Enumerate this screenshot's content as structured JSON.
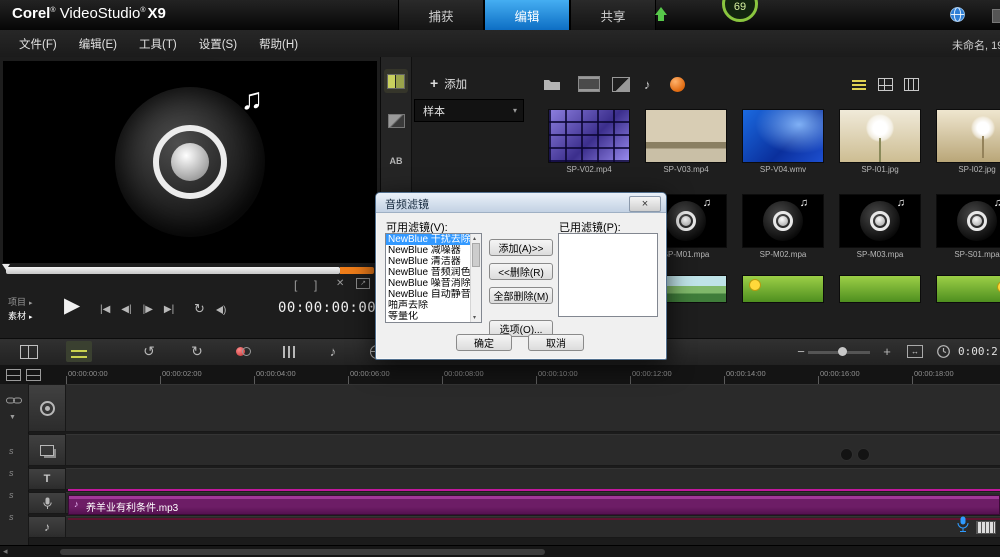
{
  "titlebar": {
    "logo": {
      "brand": "Corel",
      "product": "VideoStudio",
      "version": "X9",
      "reg": "®"
    },
    "tabs": [
      {
        "name": "capture",
        "label": "捕获",
        "active": false
      },
      {
        "name": "edit",
        "label": "编辑",
        "active": true
      },
      {
        "name": "share",
        "label": "共享",
        "active": false
      }
    ],
    "badge_value": "69"
  },
  "menubar": {
    "items": [
      {
        "name": "file",
        "label": "文件(F)"
      },
      {
        "name": "edit",
        "label": "编辑(E)"
      },
      {
        "name": "tools",
        "label": "工具(T)"
      },
      {
        "name": "settings",
        "label": "设置(S)"
      },
      {
        "name": "help",
        "label": "帮助(H)"
      }
    ],
    "project_info": "未命名, 19"
  },
  "preview": {
    "mode_project": "项目",
    "mode_clip": "素材",
    "timecode": "00:00:00:00",
    "transport": [
      {
        "name": "go-start",
        "glyph": "|◀"
      },
      {
        "name": "prev-frame",
        "glyph": "◀|"
      },
      {
        "name": "next-frame",
        "glyph": "|▶"
      },
      {
        "name": "go-end",
        "glyph": "▶|"
      }
    ]
  },
  "library": {
    "add_label": "添加",
    "gallery_label": "样本",
    "thumbs": [
      {
        "row": 0,
        "col": 0,
        "label": "SP-V02.mp4",
        "art": "screens"
      },
      {
        "row": 0,
        "col": 1,
        "label": "SP-V03.mp4",
        "art": "beige"
      },
      {
        "row": 0,
        "col": 2,
        "label": "SP-V04.wmv",
        "art": "blue"
      },
      {
        "row": 0,
        "col": 3,
        "label": "SP-I01.jpg",
        "art": "dandelion"
      },
      {
        "row": 0,
        "col": 4,
        "label": "SP-I02.jpg",
        "art": "dandelion2"
      },
      {
        "row": 1,
        "col": 1,
        "label": "SP-M01.mpa",
        "art": "speaker"
      },
      {
        "row": 1,
        "col": 2,
        "label": "SP-M02.mpa",
        "art": "speaker"
      },
      {
        "row": 1,
        "col": 3,
        "label": "SP-M03.mpa",
        "art": "speaker"
      },
      {
        "row": 1,
        "col": 4,
        "label": "SP-S01.mpa",
        "art": "speaker"
      },
      {
        "row": 2,
        "col": 1,
        "label": "",
        "art": "landscape"
      },
      {
        "row": 2,
        "col": 2,
        "label": "",
        "art": "green-smiley"
      },
      {
        "row": 2,
        "col": 3,
        "label": "",
        "art": "green"
      },
      {
        "row": 2,
        "col": 4,
        "label": "",
        "art": "green-smiley2"
      }
    ]
  },
  "dialog": {
    "title": "音频滤镜",
    "available_label": "可用滤镜(V):",
    "applied_label": "已用滤镜(P):",
    "filters": [
      "NewBlue 干扰去除器",
      "NewBlue 减噪器",
      "NewBlue 清洁器",
      "NewBlue 音频润色",
      "NewBlue 噪音消除器",
      "NewBlue 自动静音",
      "啪声去除",
      "等量化"
    ],
    "selected_index": 0,
    "add_button": "添加(A)>>",
    "remove_button": "<<删除(R)",
    "remove_all_button": "全部删除(M)",
    "options_button": "选项(O)...",
    "ok_button": "确定",
    "cancel_button": "取消"
  },
  "timeline": {
    "ruler_labels": [
      "00:00:00:00",
      "00:00:02:00",
      "00:00:04:00",
      "00:00:06:00",
      "00:00:08:00",
      "00:00:10:00",
      "00:00:12:00",
      "00:00:14:00",
      "00:00:16:00",
      "00:00:18:00"
    ],
    "clip_label": "养羊业有利条件.mp3",
    "duration_display": "0:00:2"
  },
  "icons": {
    "undo": "↺",
    "redo": "↻",
    "play": "▶",
    "loop": "↻",
    "music_note": "♪",
    "double_note": "♫",
    "zoom_out": "−",
    "zoom_in": "+",
    "fit": "↔",
    "chevron_down": "▾",
    "caret_down": "▼",
    "scroll_left": "◂",
    "mark_in": "[",
    "mark_out": "]",
    "trim": "✕",
    "enlarge": "↗",
    "close": "×",
    "up_scroll": "▴",
    "down_scroll": "▾",
    "title_track": "T",
    "ab": "AB",
    "mode_arrow": "▸",
    "s_toggle": "s"
  },
  "colors": {
    "accent_blue": "#1787dd",
    "clip_purple": "#6d1d66",
    "selection_blue": "#3399ff",
    "upload_green": "#57c84a"
  }
}
